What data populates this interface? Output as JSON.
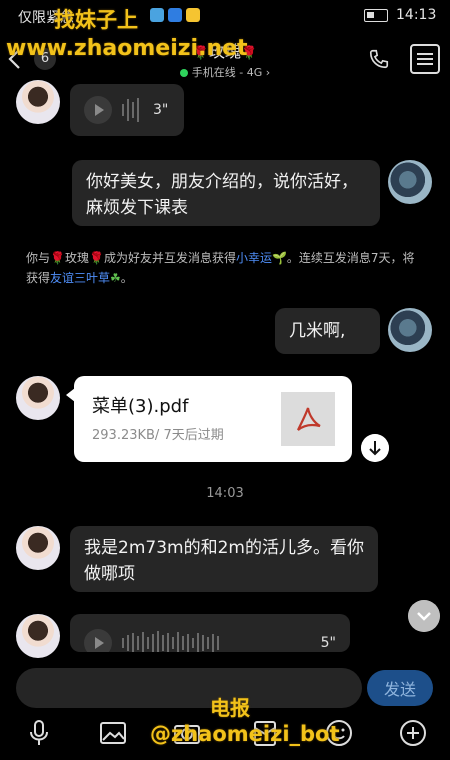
{
  "status_bar": {
    "carrier": "仅限紧急",
    "time": "14:13"
  },
  "header": {
    "unread_count": "6",
    "title": "玫瑰",
    "online_status": "手机在线 - 4G"
  },
  "messages": {
    "voice1_duration": "3\"",
    "me_text1": "你好美女，朋友介绍的，说你活好，麻烦发下课表",
    "system": {
      "p1": "你与",
      "p2": "玫瑰",
      "p3": "成为好友并互发消息获得",
      "link1": "小幸运",
      "p4": "。连续互发消息7天，将获得",
      "link2": "友谊三叶草",
      "p5": "。"
    },
    "me_text2": "几米啊,",
    "file": {
      "name": "菜单(3).pdf",
      "meta": "293.23KB/ 7天后过期"
    },
    "time_divider": "14:03",
    "her_text": "我是2m73m的和2m的活儿多。看你做哪项",
    "voice2_duration": "5\""
  },
  "input": {
    "placeholder": "",
    "send_label": "发送"
  },
  "watermarks": {
    "wm1": "找妹子上",
    "wm2": "www.zhaomeizi.net",
    "wm3": "电报",
    "wm4": "@zhaomeizi_bot"
  },
  "colors": {
    "accent": "#4f8ef7",
    "online": "#2fd35c",
    "watermark": "#f2c21a"
  }
}
